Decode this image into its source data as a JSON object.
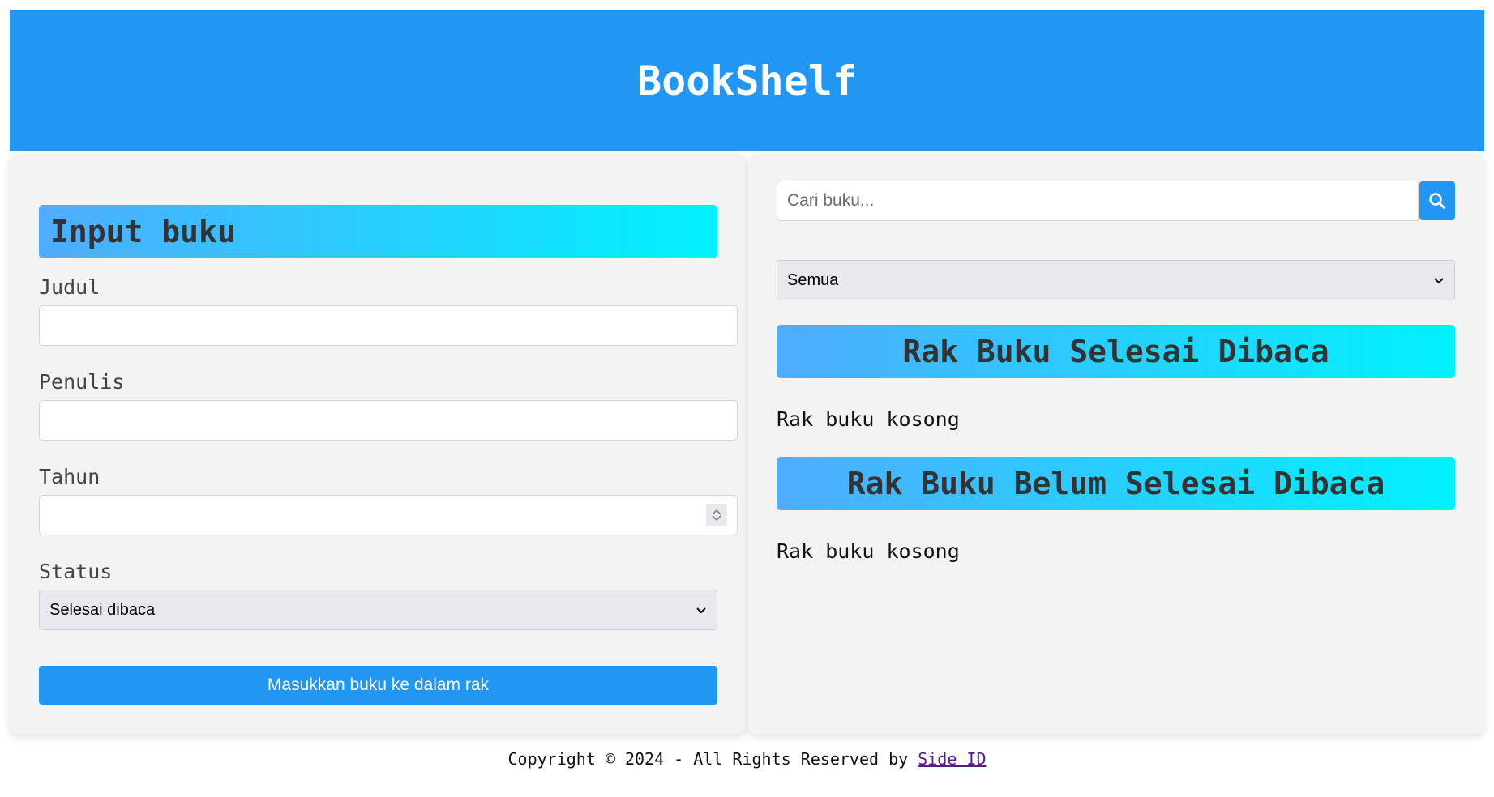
{
  "header": {
    "title": "BookShelf"
  },
  "form": {
    "heading": "Input buku",
    "title_label": "Judul",
    "title_value": "",
    "author_label": "Penulis",
    "author_value": "",
    "year_label": "Tahun",
    "year_value": "",
    "status_label": "Status",
    "status_selected": "Selesai dibaca",
    "submit_label": "Masukkan buku ke dalam rak"
  },
  "shelf": {
    "search_placeholder": "Cari buku...",
    "filter_selected": "Semua",
    "finished_heading": "Rak Buku Selesai Dibaca",
    "finished_empty": "Rak buku kosong",
    "unfinished_heading": "Rak Buku Belum Selesai Dibaca",
    "unfinished_empty": "Rak buku kosong"
  },
  "footer": {
    "text": "Copyright © 2024 - All Rights Reserved by ",
    "link_label": "Side ID"
  },
  "colors": {
    "primary": "#2196f3",
    "gradient_start": "#4facfe",
    "gradient_end": "#00f2fe",
    "panel_bg": "#f3f3f4"
  },
  "icons": {
    "search": "search-icon",
    "chevron": "chevron-down-icon",
    "spinner": "number-spinner-icon"
  }
}
